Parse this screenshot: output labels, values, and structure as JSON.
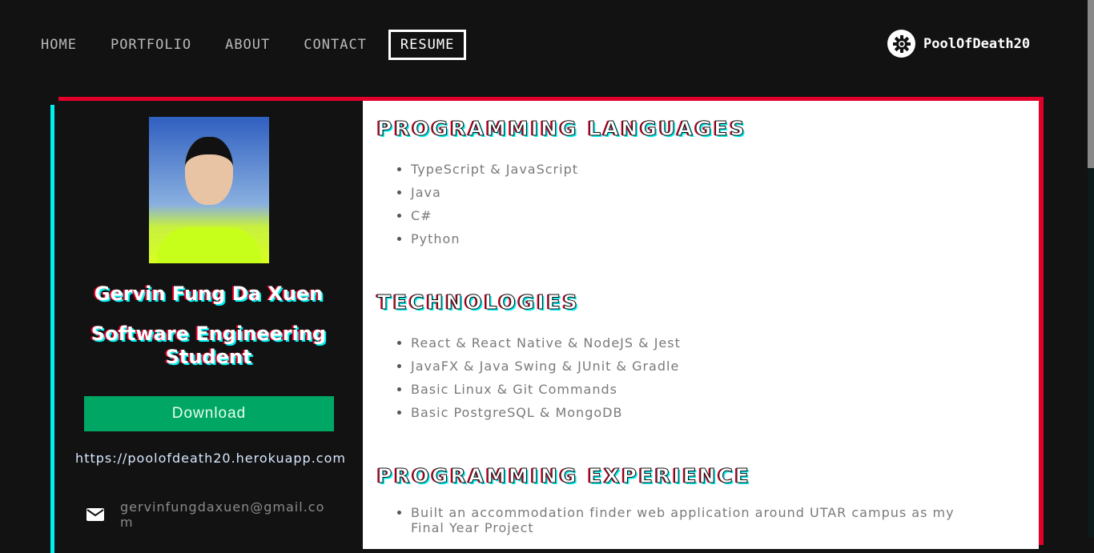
{
  "nav": {
    "items": [
      "HOME",
      "PORTFOLIO",
      "ABOUT",
      "CONTACT",
      "RESUME"
    ],
    "active": "RESUME"
  },
  "brand": {
    "name": "PoolOfDeath20",
    "icon": "gear-icon"
  },
  "profile": {
    "name": "Gervin Fung Da Xuen",
    "role": "Software Engineering Student",
    "download_label": "Download",
    "url": "https://poolofdeath20.herokuapp.com",
    "email": "gervinfungdaxuen@gmail.com"
  },
  "sections": [
    {
      "title": "PROGRAMMING LANGUAGES",
      "items": [
        "TypeScript & JavaScript",
        "Java",
        "C#",
        "Python"
      ]
    },
    {
      "title": "TECHNOLOGIES",
      "items": [
        "React & React Native & NodeJS & Jest",
        "JavaFX & Java Swing & JUnit & Gradle",
        "Basic Linux & Git Commands",
        "Basic PostgreSQL & MongoDB"
      ]
    },
    {
      "title": "PROGRAMMING EXPERIENCE",
      "items": [
        "Built an accommodation finder web application around UTAR campus as my Final Year Project"
      ]
    }
  ],
  "colors": {
    "accent_red": "#e0002a",
    "accent_cyan": "#00f0f0",
    "download_green": "#00a664",
    "background": "#121212"
  }
}
